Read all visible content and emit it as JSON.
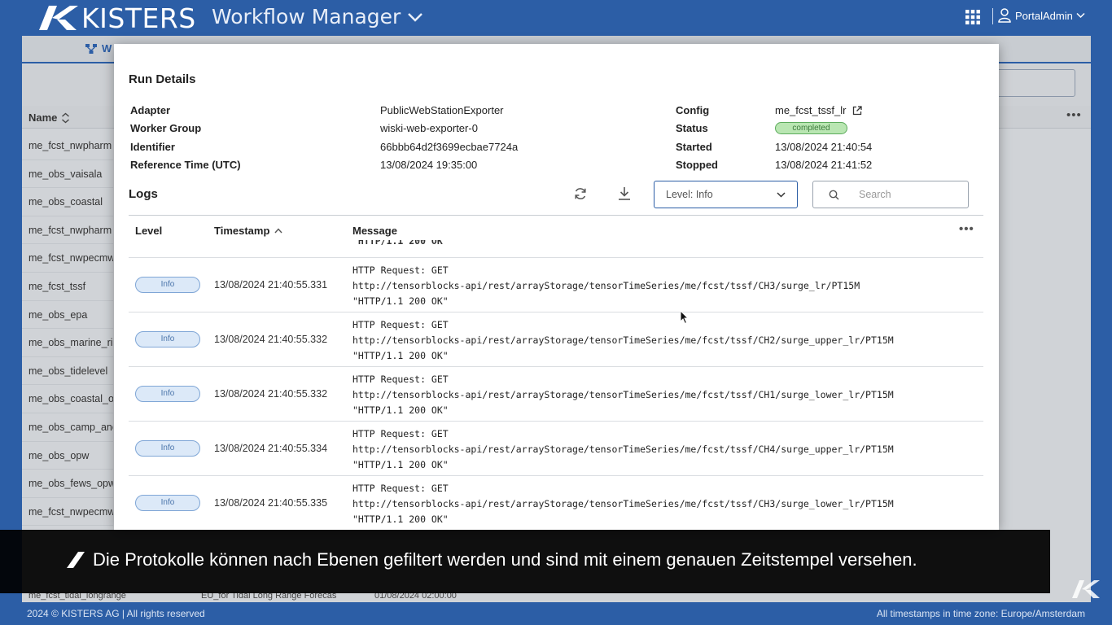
{
  "header": {
    "brand": "KISTERS",
    "app_title": "Workflow Manager",
    "user_name": "PortalAdmin"
  },
  "background": {
    "tab_label": "W",
    "name_column": "Name",
    "rows": [
      "me_fcst_nwpharm",
      "me_obs_vaisala",
      "me_obs_coastal",
      "me_fcst_nwpharm",
      "me_fcst_nwpecmw",
      "me_fcst_tssf",
      "me_obs_epa",
      "me_obs_marine_ri",
      "me_obs_tidelevel",
      "me_obs_coastal_o",
      "me_obs_camp_anc",
      "me_obs_opw",
      "me_obs_fews_opw",
      "me_fcst_nwpecmw"
    ],
    "last_row": {
      "name": "me_fcst_tidal_longrange",
      "description": "EU_for Tidal Long Range Forecas",
      "date": "01/08/2024 02:00:00"
    }
  },
  "run_details": {
    "title": "Run Details",
    "adapter_label": "Adapter",
    "adapter_value": "PublicWebStationExporter",
    "worker_group_label": "Worker Group",
    "worker_group_value": "wiski-web-exporter-0",
    "identifier_label": "Identifier",
    "identifier_value": "66bbb64d2f3699ecbae7724a",
    "reference_time_label": "Reference Time (UTC)",
    "reference_time_value": "13/08/2024 19:35:00",
    "config_label": "Config",
    "config_value": "me_fcst_tssf_lr",
    "status_label": "Status",
    "status_value": "completed",
    "started_label": "Started",
    "started_value": "13/08/2024 21:40:54",
    "stopped_label": "Stopped",
    "stopped_value": "13/08/2024 21:41:52"
  },
  "logs": {
    "title": "Logs",
    "level_filter": "Level: Info",
    "search_placeholder": "Search",
    "columns": {
      "level": "Level",
      "timestamp": "Timestamp",
      "message": "Message"
    },
    "partial_line": "\"HTTP/1.1 200 OK\"",
    "rows": [
      {
        "level": "Info",
        "timestamp": "13/08/2024 21:40:55.331",
        "line1": "HTTP Request: GET",
        "line2": "http://tensorblocks-api/rest/arrayStorage/tensorTimeSeries/me/fcst/tssf/CH3/surge_lr/PT15M",
        "line3": "\"HTTP/1.1 200 OK\""
      },
      {
        "level": "Info",
        "timestamp": "13/08/2024 21:40:55.332",
        "line1": "HTTP Request: GET",
        "line2": "http://tensorblocks-api/rest/arrayStorage/tensorTimeSeries/me/fcst/tssf/CH2/surge_upper_lr/PT15M",
        "line3": "\"HTTP/1.1 200 OK\""
      },
      {
        "level": "Info",
        "timestamp": "13/08/2024 21:40:55.332",
        "line1": "HTTP Request: GET",
        "line2": "http://tensorblocks-api/rest/arrayStorage/tensorTimeSeries/me/fcst/tssf/CH1/surge_lower_lr/PT15M",
        "line3": "\"HTTP/1.1 200 OK\""
      },
      {
        "level": "Info",
        "timestamp": "13/08/2024 21:40:55.334",
        "line1": "HTTP Request: GET",
        "line2": "http://tensorblocks-api/rest/arrayStorage/tensorTimeSeries/me/fcst/tssf/CH4/surge_upper_lr/PT15M",
        "line3": "\"HTTP/1.1 200 OK\""
      },
      {
        "level": "Info",
        "timestamp": "13/08/2024 21:40:55.335",
        "line1": "HTTP Request: GET",
        "line2": "http://tensorblocks-api/rest/arrayStorage/tensorTimeSeries/me/fcst/tssf/CH3/surge_lower_lr/PT15M",
        "line3": "\"HTTP/1.1 200 OK\""
      }
    ]
  },
  "subtitle": "Die Protokolle können nach Ebenen gefiltert werden und sind mit einem genauen Zeitstempel versehen.",
  "footer": {
    "copyright": "2024 © KISTERS AG | All rights reserved",
    "timezone": "All timestamps in time zone: Europe/Amsterdam"
  },
  "colors": {
    "brand_blue": "#2c5ea6",
    "status_completed": "#b9e6b2",
    "info_pill": "#dce9f8"
  }
}
